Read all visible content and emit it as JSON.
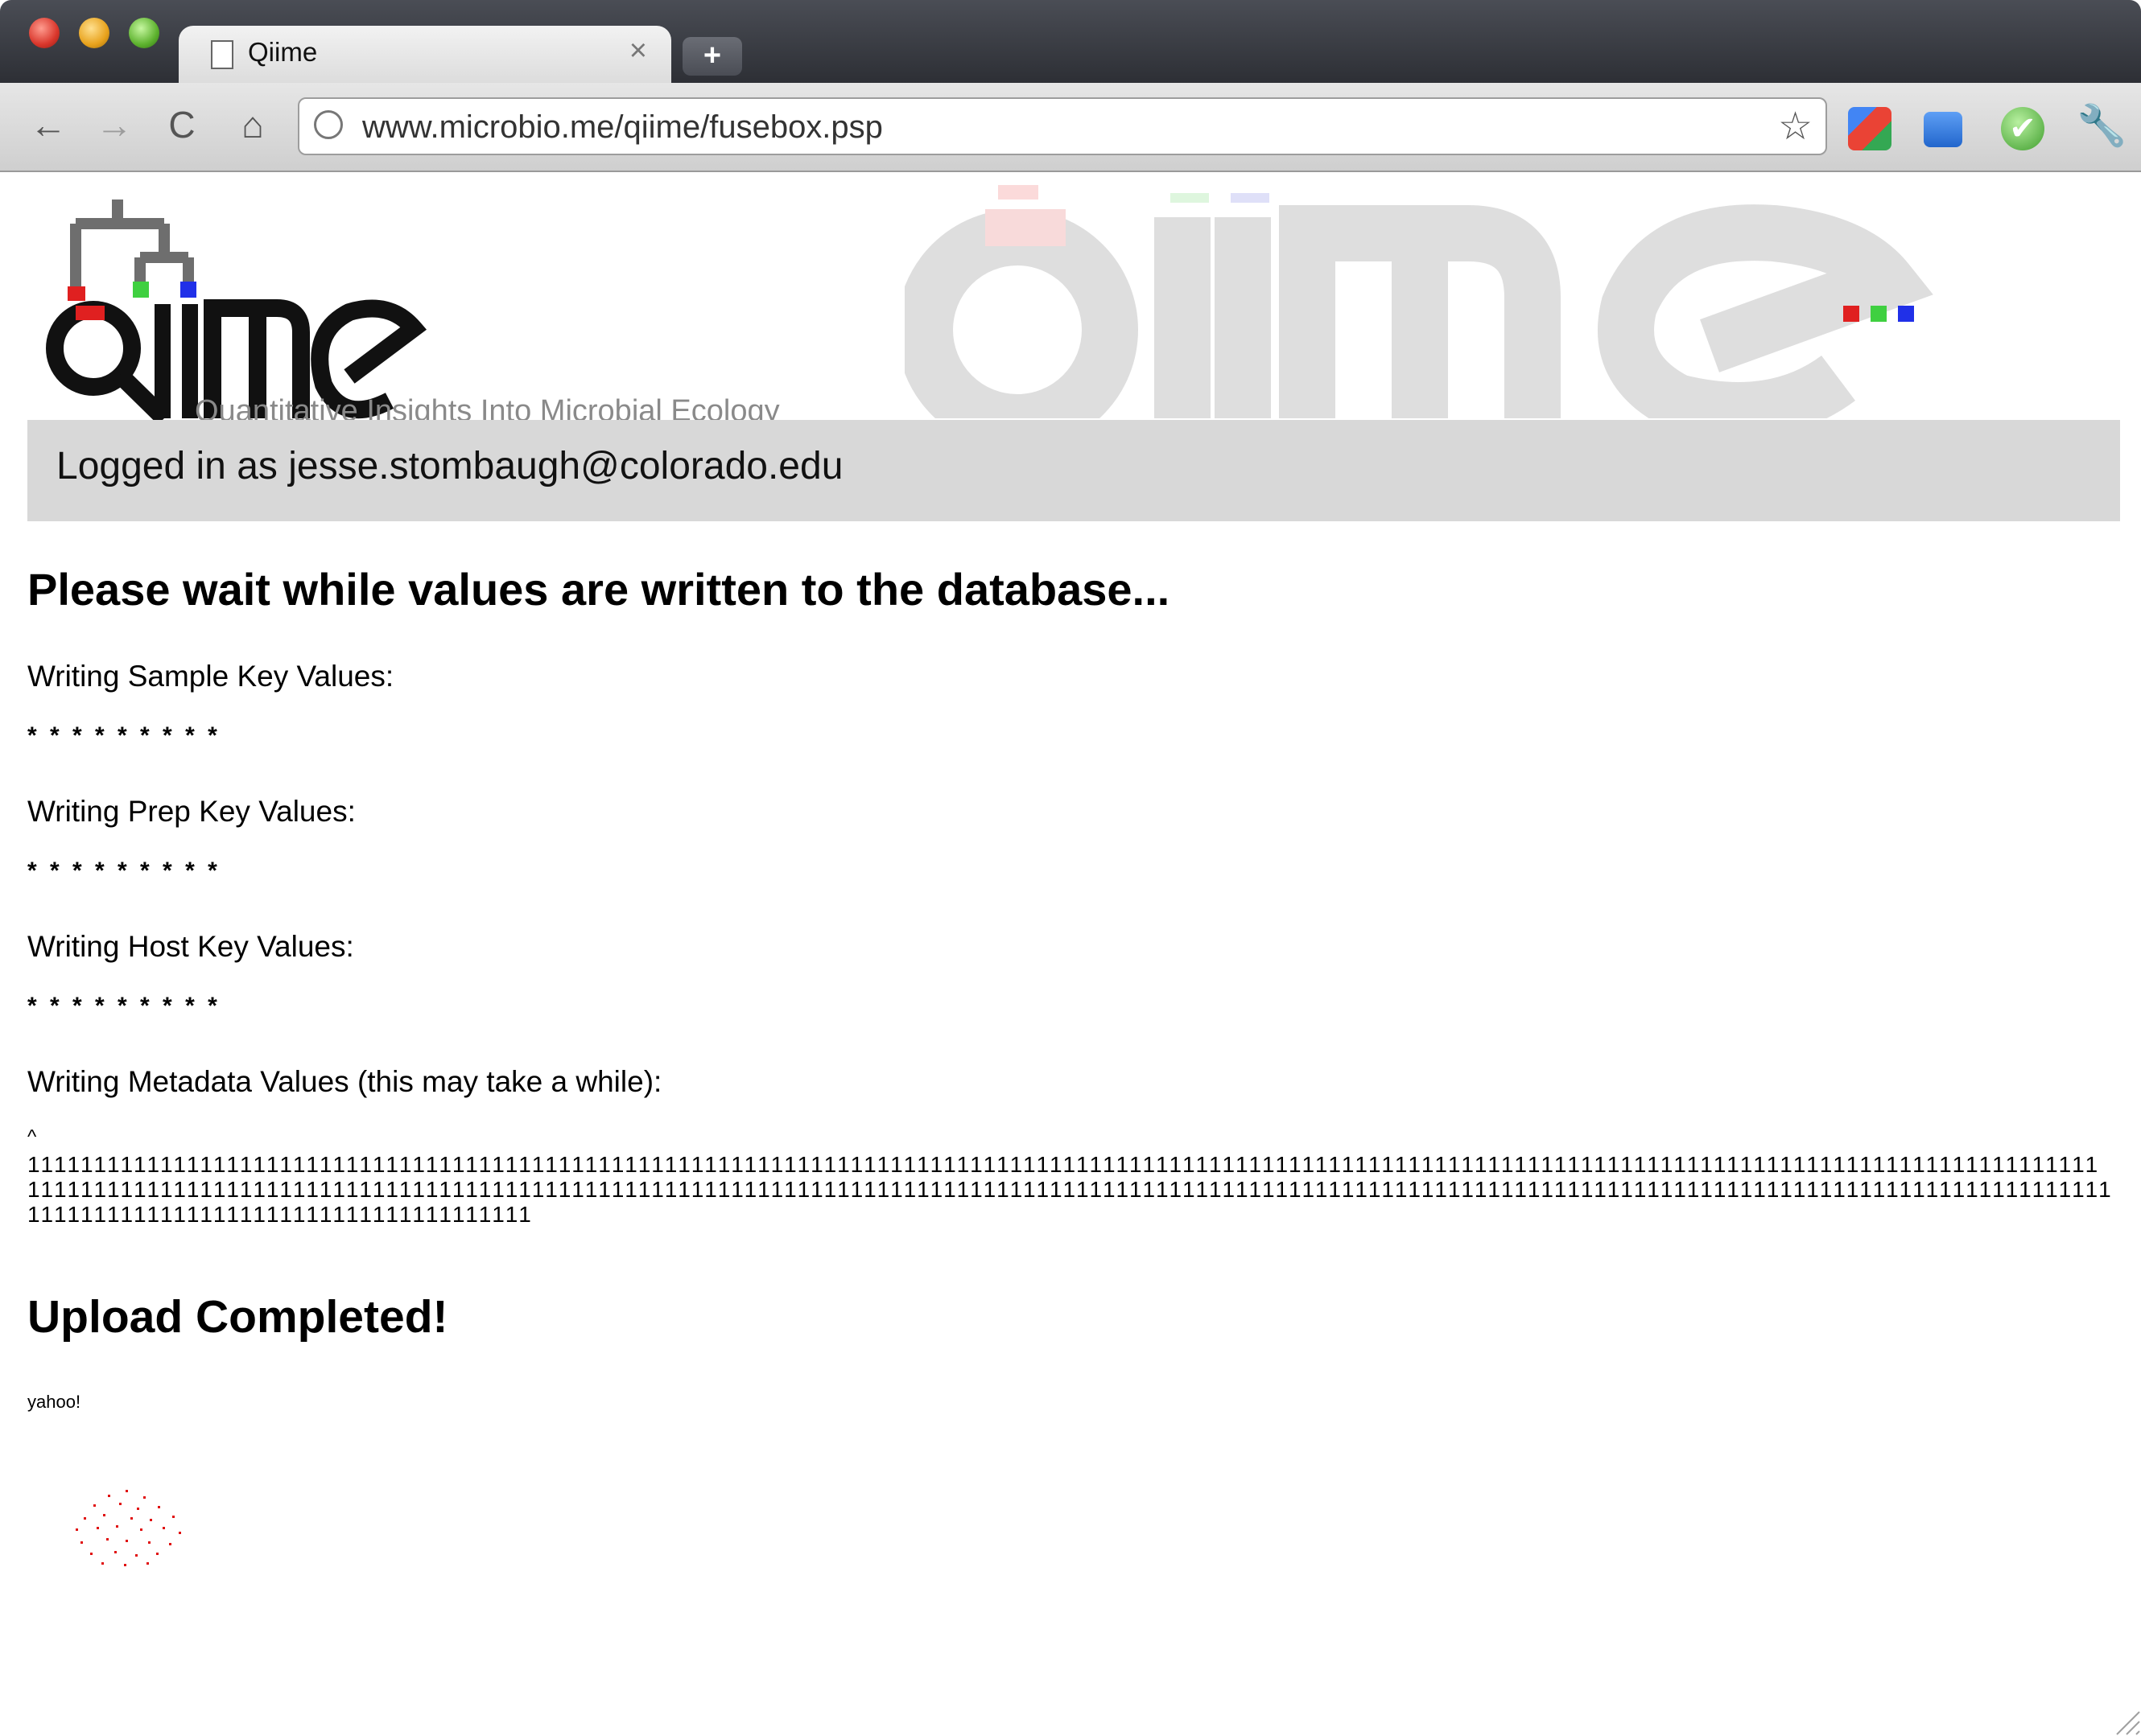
{
  "browser": {
    "tab_title": "Qiime",
    "tab_close": "×",
    "new_tab": "+",
    "url": "www.microbio.me/qiime/fusebox.psp",
    "back": "←",
    "forward": "→",
    "reload": "C",
    "home": "⌂",
    "bookmark_star": "☆",
    "wrench": "🔧",
    "extension_check": "✔"
  },
  "header": {
    "logo_text": "qiime",
    "logo_subtitle": "Quantitative Insights Into Microbial Ecology",
    "watermark_text": "qiime",
    "accent_colors": [
      "#e02020",
      "#3fd040",
      "#2030e8"
    ]
  },
  "login": {
    "text": "Logged in as jesse.stombaugh@colorado.edu"
  },
  "main": {
    "heading": "Please wait while values are written to the database...",
    "sections": [
      {
        "label": "Writing Sample Key Values:",
        "progress": "* * * * * * * * *"
      },
      {
        "label": "Writing Prep Key Values:",
        "progress": "* * * * * * * * *"
      },
      {
        "label": "Writing Host Key Values:",
        "progress": "* * * * * * * * *"
      }
    ],
    "metadata_label": "Writing Metadata Values (this may take a while):",
    "metadata_caret": "^",
    "metadata_progress": "111111111111111111111111111111111111111111111111111111111111111111111111111111111111111111111111111111111111111111111111111111111111111111111111111111111111111111111111111111111111111111111111111111111111111111111111111111111111111111111111111111111111111111111111111111111111111111111111111111111111111111111111111111111111111111111111111111111111111",
    "complete_heading": "Upload Completed!",
    "complete_message": "yahoo!"
  }
}
